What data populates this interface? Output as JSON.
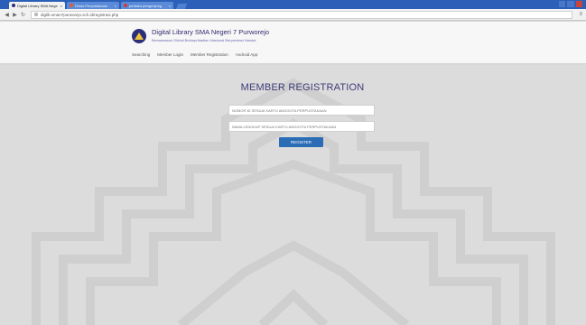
{
  "browser": {
    "tabs": [
      {
        "label": "Digital Library SMA Nege",
        "active": true,
        "favicon_color": "#2b2f7a"
      },
      {
        "label": "Dinas Perpustakaan",
        "active": false,
        "favicon_color": "#e25b2b"
      },
      {
        "label": "perilaku pengunjung",
        "active": false,
        "favicon_color": "#d33b3b"
      }
    ],
    "url": "diglib.sman7purworejo.sch.id/registrasi.php"
  },
  "site": {
    "title": "Digital Library SMA Negeri 7 Purworejo",
    "subtitle": "Berwawasan Global Berkepribadian Nasional Berprestasi Handal",
    "nav": [
      "Searching",
      "Member Login",
      "Member Registration",
      "Android App"
    ]
  },
  "registration": {
    "heading": "MEMBER REGISTRATION",
    "id_placeholder": "NOMOR ID SESUAI KARTU ANGGOTA PERPUSTAKAAN",
    "name_placeholder": "NAMA LENGKAP SESUAI KARTU ANGGOTA PERPUSTAKAAN",
    "button_label": "REGISTER"
  },
  "colors": {
    "accent": "#2a6cb5",
    "title": "#3d3a78",
    "browser_bar": "#2b5fb8"
  }
}
